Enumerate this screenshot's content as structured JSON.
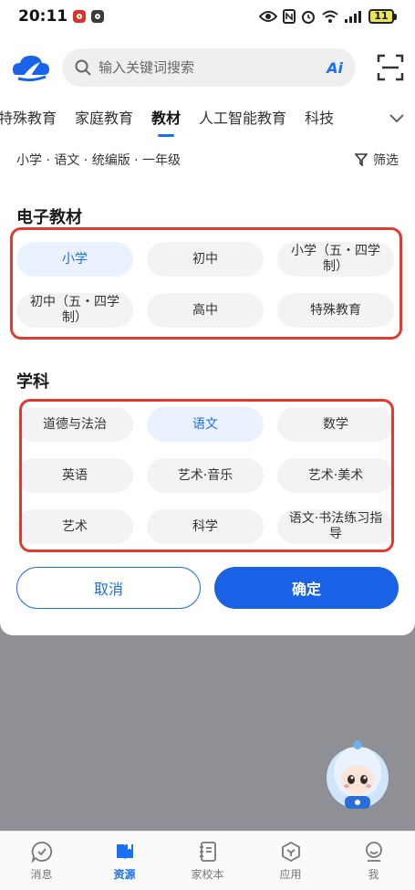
{
  "status_bar": {
    "time": "20:11",
    "battery": "11"
  },
  "search": {
    "placeholder": "输入关键词搜索",
    "ai_label": "Ai"
  },
  "tabs": [
    "特殊教育",
    "家庭教育",
    "教材",
    "人工智能教育",
    "科技"
  ],
  "active_tab": "教材",
  "filter": {
    "breadcrumb": "小学 · 语文 · 统编版 · 一年级",
    "filter_label": "筛选"
  },
  "panel": {
    "section1_title": "电子教材",
    "section1_options": [
      "小学",
      "初中",
      "小学（五・四学制）",
      "初中（五・四学制）",
      "高中",
      "特殊教育"
    ],
    "section1_selected": "小学",
    "section2_title": "学科",
    "section2_options": [
      "道德与法治",
      "语文",
      "数学",
      "英语",
      "艺术·音乐",
      "艺术·美术",
      "艺术",
      "科学",
      "语文·书法练习指导"
    ],
    "section2_selected": "语文",
    "cancel_label": "取消",
    "confirm_label": "确定"
  },
  "bottom_nav": {
    "items": [
      "消息",
      "资源",
      "家校本",
      "应用",
      "我"
    ],
    "active": "资源"
  },
  "colors": {
    "accent": "#1a6ff2",
    "highlight_box": "#e03b2e",
    "overlay": "#8f9096"
  }
}
